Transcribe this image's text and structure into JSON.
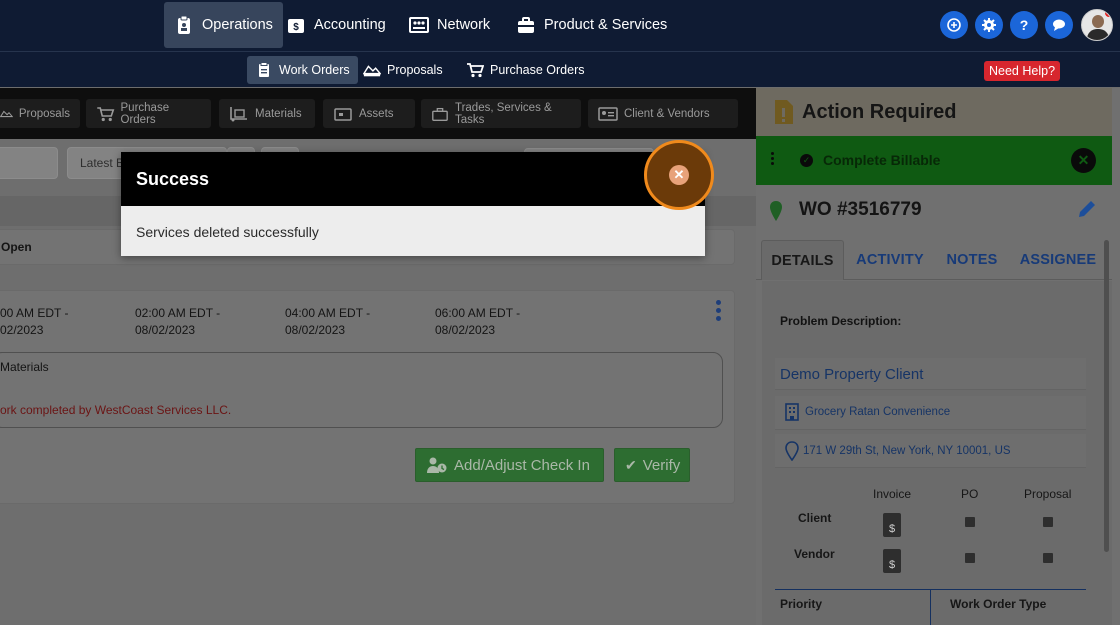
{
  "topnav": {
    "items": [
      {
        "label": "Operations",
        "icon": "clipboard-icon"
      },
      {
        "label": "Accounting",
        "icon": "dollar-icon"
      },
      {
        "label": "Network",
        "icon": "network-icon"
      },
      {
        "label": "Product & Services",
        "icon": "briefcase-icon"
      }
    ],
    "icons": [
      "plus-circle-icon",
      "gear-icon",
      "question-icon",
      "chat-icon"
    ],
    "help_glyph": "?"
  },
  "subnav": {
    "items": [
      {
        "label": "Work Orders"
      },
      {
        "label": "Proposals"
      },
      {
        "label": "Purchase Orders"
      }
    ],
    "help_button": "Need Help?"
  },
  "tabbar": {
    "items": [
      {
        "label": "Proposals"
      },
      {
        "label": "Purchase Orders"
      },
      {
        "label": "Materials"
      },
      {
        "label": "Assets"
      },
      {
        "label": "Trades, Services & Tasks"
      },
      {
        "label": "Client & Vendors"
      }
    ]
  },
  "main": {
    "filter_placeholder": "Latest B",
    "status_label": "Open",
    "times": [
      {
        "time": "00 AM EDT -",
        "date": "02/2023"
      },
      {
        "time": "02:00 AM EDT -",
        "date": "08/02/2023"
      },
      {
        "time": "04:00 AM EDT -",
        "date": "08/02/2023"
      },
      {
        "time": "06:00 AM EDT -",
        "date": "08/02/2023"
      }
    ],
    "materials_label": "Materials",
    "work_completed_note": "ork completed by WestCoast Services LLC.",
    "add_checkin_label": "Add/Adjust Check In",
    "verify_label": "Verify"
  },
  "modal": {
    "title": "Success",
    "message": "Services deleted successfully",
    "close_glyph": "✕"
  },
  "right": {
    "action_required": "Action Required",
    "complete_billable": "Complete Billable",
    "wo_number": "WO #3516779",
    "tabs": [
      {
        "label": "DETAILS"
      },
      {
        "label": "ACTIVITY"
      },
      {
        "label": "NOTES"
      },
      {
        "label": "ASSIGNEE"
      }
    ],
    "problem_description_label": "Problem Description:",
    "client_name": "Demo Property Client",
    "store_name": "Grocery Ratan Convenience",
    "address": "171 W 29th St, New York, NY 10001, US",
    "doc_headers": [
      "Invoice",
      "PO",
      "Proposal"
    ],
    "doc_rows": [
      "Client",
      "Vendor"
    ],
    "doc_glyph": "$",
    "priority_label": "Priority",
    "work_order_type_label": "Work Order Type"
  }
}
